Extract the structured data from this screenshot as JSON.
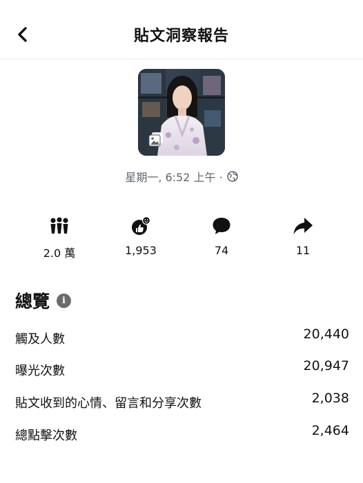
{
  "header": {
    "title": "貼文洞察報告",
    "back_icon": "chevron-left-icon"
  },
  "post": {
    "badge_icon": "photo-album-icon",
    "time": "星期一, 6:52 上午 ·",
    "privacy_icon": "globe-icon"
  },
  "stats": [
    {
      "icon": "reach-icon",
      "value": "2.0 萬"
    },
    {
      "icon": "reactions-icon",
      "value": "1,953"
    },
    {
      "icon": "comment-icon",
      "value": "74"
    },
    {
      "icon": "share-icon",
      "value": "11"
    }
  ],
  "overview": {
    "title": "總覽",
    "info_icon": "i",
    "metrics": [
      {
        "label": "觸及人數",
        "value": "20,440"
      },
      {
        "label": "曝光次數",
        "value": "20,947"
      },
      {
        "label": "貼文收到的心情、留言和分享次數",
        "value": "2,038"
      },
      {
        "label": "總點擊次數",
        "value": "2,464"
      }
    ]
  }
}
